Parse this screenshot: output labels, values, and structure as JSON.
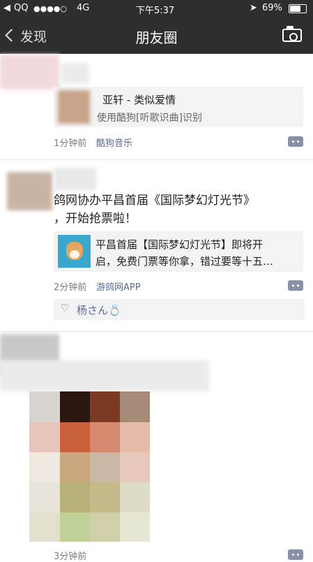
{
  "status_bar": {
    "carrier": "QQ",
    "signal": "●●●●○",
    "network": "4G",
    "time": "下午5:37",
    "battery": "69%"
  },
  "nav": {
    "back_label": "发现",
    "title": "朋友圈"
  },
  "posts": [
    {
      "link_title": "亚轩 - 类似爱情",
      "link_subtitle": "使用酷狗[听歌识曲]识别",
      "time": "1分钟前",
      "source": "酷狗音乐"
    },
    {
      "text_line1": "鸽网协办平昌首届《国际梦幻灯光节》",
      "text_line2": "，开始抢票啦！",
      "card_text_line1": "平昌首届【国际梦幻灯光节】即将开",
      "card_text_line2": "启，免费门票等你拿，错过要等十五…",
      "time": "2分钟前",
      "source": "游鸽网APP",
      "like_name": "杨さん💍"
    },
    {
      "time": "3分钟前"
    }
  ],
  "colors": {
    "nav_bg": "#2e2e2e",
    "link": "#566b94",
    "card_bg": "#f3f3f5"
  }
}
